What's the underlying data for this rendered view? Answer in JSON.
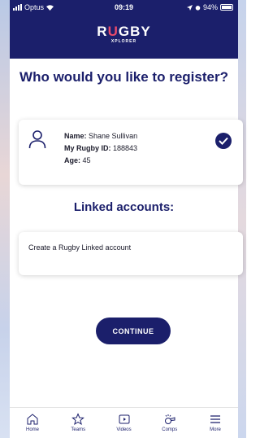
{
  "status_bar": {
    "carrier": "Optus",
    "time": "09:19",
    "battery": "94%"
  },
  "logo": {
    "main_pre": "R",
    "main_accent": "U",
    "main_post": "GBY",
    "sub": "XPLORER"
  },
  "title": "Who would you like to register?",
  "user": {
    "name_label": "Name:",
    "name": "Shane Sullivan",
    "id_label": "My Rugby ID:",
    "id": "188843",
    "age_label": "Age:",
    "age": "45",
    "selected": true
  },
  "linked_section_title": "Linked accounts:",
  "linked_card_label": "Create a Rugby Linked account",
  "continue_label": "CONTINUE",
  "tabs": [
    {
      "label": "Home",
      "icon": "home-icon"
    },
    {
      "label": "Teams",
      "icon": "star-icon"
    },
    {
      "label": "Videos",
      "icon": "play-icon"
    },
    {
      "label": "Comps",
      "icon": "whistle-icon"
    },
    {
      "label": "More",
      "icon": "menu-icon"
    }
  ],
  "colors": {
    "primary": "#1b1f6b",
    "accent": "#e94b6b"
  }
}
